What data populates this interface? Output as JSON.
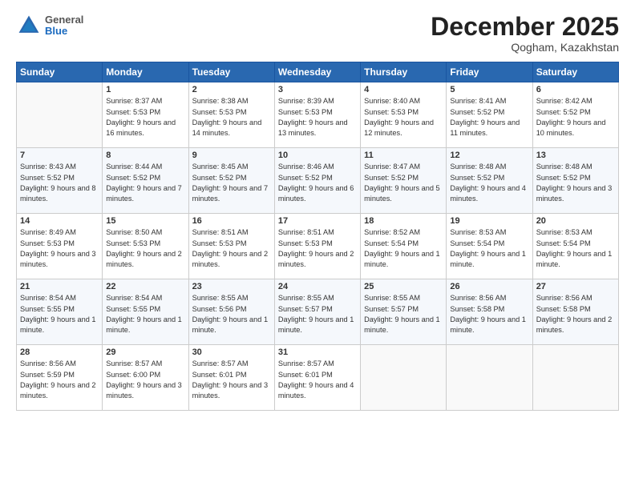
{
  "header": {
    "logo": {
      "general": "General",
      "blue": "Blue"
    },
    "title": "December 2025",
    "location": "Qogham, Kazakhstan"
  },
  "weekdays": [
    "Sunday",
    "Monday",
    "Tuesday",
    "Wednesday",
    "Thursday",
    "Friday",
    "Saturday"
  ],
  "weeks": [
    [
      {
        "num": "",
        "sunrise": "",
        "sunset": "",
        "daylight": ""
      },
      {
        "num": "1",
        "sunrise": "Sunrise: 8:37 AM",
        "sunset": "Sunset: 5:53 PM",
        "daylight": "Daylight: 9 hours and 16 minutes."
      },
      {
        "num": "2",
        "sunrise": "Sunrise: 8:38 AM",
        "sunset": "Sunset: 5:53 PM",
        "daylight": "Daylight: 9 hours and 14 minutes."
      },
      {
        "num": "3",
        "sunrise": "Sunrise: 8:39 AM",
        "sunset": "Sunset: 5:53 PM",
        "daylight": "Daylight: 9 hours and 13 minutes."
      },
      {
        "num": "4",
        "sunrise": "Sunrise: 8:40 AM",
        "sunset": "Sunset: 5:53 PM",
        "daylight": "Daylight: 9 hours and 12 minutes."
      },
      {
        "num": "5",
        "sunrise": "Sunrise: 8:41 AM",
        "sunset": "Sunset: 5:52 PM",
        "daylight": "Daylight: 9 hours and 11 minutes."
      },
      {
        "num": "6",
        "sunrise": "Sunrise: 8:42 AM",
        "sunset": "Sunset: 5:52 PM",
        "daylight": "Daylight: 9 hours and 10 minutes."
      }
    ],
    [
      {
        "num": "7",
        "sunrise": "Sunrise: 8:43 AM",
        "sunset": "Sunset: 5:52 PM",
        "daylight": "Daylight: 9 hours and 8 minutes."
      },
      {
        "num": "8",
        "sunrise": "Sunrise: 8:44 AM",
        "sunset": "Sunset: 5:52 PM",
        "daylight": "Daylight: 9 hours and 7 minutes."
      },
      {
        "num": "9",
        "sunrise": "Sunrise: 8:45 AM",
        "sunset": "Sunset: 5:52 PM",
        "daylight": "Daylight: 9 hours and 7 minutes."
      },
      {
        "num": "10",
        "sunrise": "Sunrise: 8:46 AM",
        "sunset": "Sunset: 5:52 PM",
        "daylight": "Daylight: 9 hours and 6 minutes."
      },
      {
        "num": "11",
        "sunrise": "Sunrise: 8:47 AM",
        "sunset": "Sunset: 5:52 PM",
        "daylight": "Daylight: 9 hours and 5 minutes."
      },
      {
        "num": "12",
        "sunrise": "Sunrise: 8:48 AM",
        "sunset": "Sunset: 5:52 PM",
        "daylight": "Daylight: 9 hours and 4 minutes."
      },
      {
        "num": "13",
        "sunrise": "Sunrise: 8:48 AM",
        "sunset": "Sunset: 5:52 PM",
        "daylight": "Daylight: 9 hours and 3 minutes."
      }
    ],
    [
      {
        "num": "14",
        "sunrise": "Sunrise: 8:49 AM",
        "sunset": "Sunset: 5:53 PM",
        "daylight": "Daylight: 9 hours and 3 minutes."
      },
      {
        "num": "15",
        "sunrise": "Sunrise: 8:50 AM",
        "sunset": "Sunset: 5:53 PM",
        "daylight": "Daylight: 9 hours and 2 minutes."
      },
      {
        "num": "16",
        "sunrise": "Sunrise: 8:51 AM",
        "sunset": "Sunset: 5:53 PM",
        "daylight": "Daylight: 9 hours and 2 minutes."
      },
      {
        "num": "17",
        "sunrise": "Sunrise: 8:51 AM",
        "sunset": "Sunset: 5:53 PM",
        "daylight": "Daylight: 9 hours and 2 minutes."
      },
      {
        "num": "18",
        "sunrise": "Sunrise: 8:52 AM",
        "sunset": "Sunset: 5:54 PM",
        "daylight": "Daylight: 9 hours and 1 minute."
      },
      {
        "num": "19",
        "sunrise": "Sunrise: 8:53 AM",
        "sunset": "Sunset: 5:54 PM",
        "daylight": "Daylight: 9 hours and 1 minute."
      },
      {
        "num": "20",
        "sunrise": "Sunrise: 8:53 AM",
        "sunset": "Sunset: 5:54 PM",
        "daylight": "Daylight: 9 hours and 1 minute."
      }
    ],
    [
      {
        "num": "21",
        "sunrise": "Sunrise: 8:54 AM",
        "sunset": "Sunset: 5:55 PM",
        "daylight": "Daylight: 9 hours and 1 minute."
      },
      {
        "num": "22",
        "sunrise": "Sunrise: 8:54 AM",
        "sunset": "Sunset: 5:55 PM",
        "daylight": "Daylight: 9 hours and 1 minute."
      },
      {
        "num": "23",
        "sunrise": "Sunrise: 8:55 AM",
        "sunset": "Sunset: 5:56 PM",
        "daylight": "Daylight: 9 hours and 1 minute."
      },
      {
        "num": "24",
        "sunrise": "Sunrise: 8:55 AM",
        "sunset": "Sunset: 5:57 PM",
        "daylight": "Daylight: 9 hours and 1 minute."
      },
      {
        "num": "25",
        "sunrise": "Sunrise: 8:55 AM",
        "sunset": "Sunset: 5:57 PM",
        "daylight": "Daylight: 9 hours and 1 minute."
      },
      {
        "num": "26",
        "sunrise": "Sunrise: 8:56 AM",
        "sunset": "Sunset: 5:58 PM",
        "daylight": "Daylight: 9 hours and 1 minute."
      },
      {
        "num": "27",
        "sunrise": "Sunrise: 8:56 AM",
        "sunset": "Sunset: 5:58 PM",
        "daylight": "Daylight: 9 hours and 2 minutes."
      }
    ],
    [
      {
        "num": "28",
        "sunrise": "Sunrise: 8:56 AM",
        "sunset": "Sunset: 5:59 PM",
        "daylight": "Daylight: 9 hours and 2 minutes."
      },
      {
        "num": "29",
        "sunrise": "Sunrise: 8:57 AM",
        "sunset": "Sunset: 6:00 PM",
        "daylight": "Daylight: 9 hours and 3 minutes."
      },
      {
        "num": "30",
        "sunrise": "Sunrise: 8:57 AM",
        "sunset": "Sunset: 6:01 PM",
        "daylight": "Daylight: 9 hours and 3 minutes."
      },
      {
        "num": "31",
        "sunrise": "Sunrise: 8:57 AM",
        "sunset": "Sunset: 6:01 PM",
        "daylight": "Daylight: 9 hours and 4 minutes."
      },
      {
        "num": "",
        "sunrise": "",
        "sunset": "",
        "daylight": ""
      },
      {
        "num": "",
        "sunrise": "",
        "sunset": "",
        "daylight": ""
      },
      {
        "num": "",
        "sunrise": "",
        "sunset": "",
        "daylight": ""
      }
    ]
  ]
}
